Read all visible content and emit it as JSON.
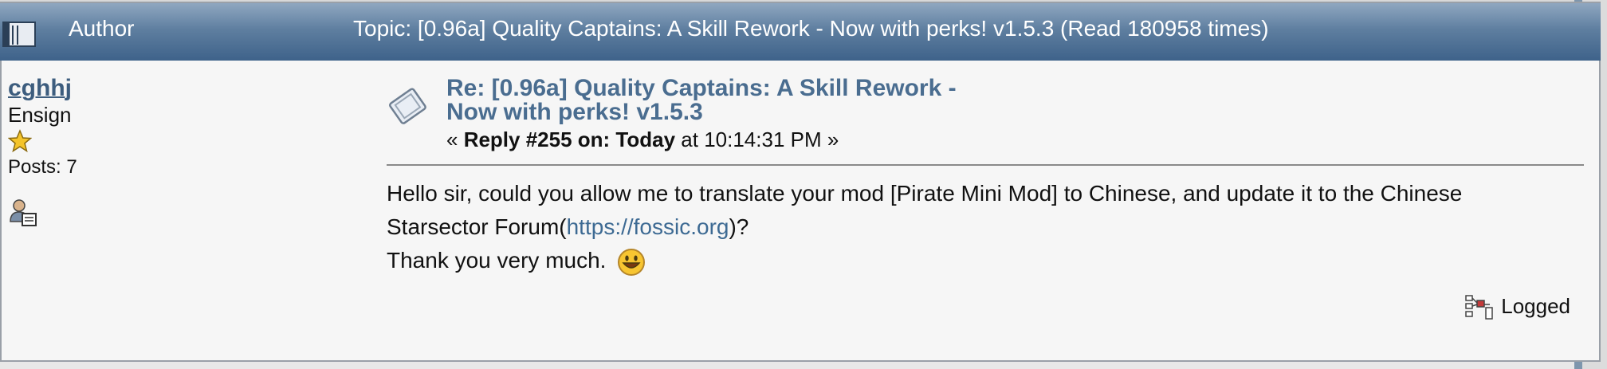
{
  "header": {
    "author_label": "Author",
    "topic_label": "Topic: [0.96a] Quality Captains: A Skill Rework - Now with perks! v1.5.3  (Read 180958 times)"
  },
  "poster": {
    "name": "cghhj",
    "rank": "Ensign",
    "posts": "Posts: 7"
  },
  "post": {
    "title_line1": "Re: [0.96a] Quality Captains: A Skill Rework -",
    "title_line2": "Now with perks! v1.5.3",
    "meta_prefix": "« ",
    "meta_reply": "Reply #255 on: Today",
    "meta_time": " at 10:14:31 PM »",
    "body_line1": "Hello sir, could you allow me to translate your mod [Pirate Mini Mod] to Chinese, and update it to the Chinese",
    "body_line2_prefix": "Starsector Forum(",
    "body_link": "https://fossic.org",
    "body_line2_suffix": ")?",
    "body_line3": "Thank you very much.",
    "logged_label": "Logged"
  },
  "colors": {
    "header_top": "#8fa7c0",
    "header_bottom": "#3e628a",
    "link": "#3d6a93",
    "title": "#4a6d90"
  },
  "icons": {
    "header": "topic-icon",
    "rank": "star-icon",
    "profile": "profile-icon",
    "post": "post-icon",
    "smiley": "smiley-icon",
    "logged": "logged-icon"
  }
}
